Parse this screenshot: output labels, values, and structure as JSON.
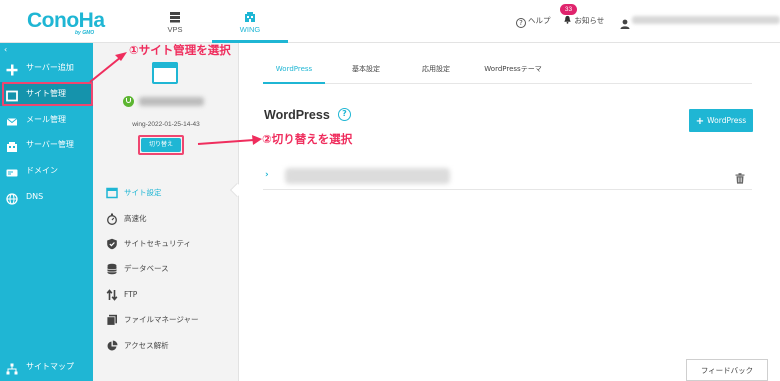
{
  "header": {
    "logo": {
      "text": "ConoHa",
      "sub": "by GMO"
    },
    "service_tabs": [
      {
        "label": "VPS"
      },
      {
        "label": "WING"
      }
    ],
    "help_label": "ヘルプ",
    "notice_label": "お知らせ",
    "notice_count": "33"
  },
  "sidebar": {
    "items": [
      {
        "label": "サーバー追加"
      },
      {
        "label": "サイト管理"
      },
      {
        "label": "メール管理"
      },
      {
        "label": "サーバー管理"
      },
      {
        "label": "ドメイン"
      },
      {
        "label": "DNS"
      }
    ],
    "bottom_label": "サイトマップ"
  },
  "site_panel": {
    "site_id": "wing-2022-01-25-14-43",
    "switch_button": "切り替え",
    "menu": [
      {
        "label": "サイト設定"
      },
      {
        "label": "高速化"
      },
      {
        "label": "サイトセキュリティ"
      },
      {
        "label": "データベース"
      },
      {
        "label": "FTP"
      },
      {
        "label": "ファイルマネージャー"
      },
      {
        "label": "アクセス解析"
      }
    ]
  },
  "main": {
    "tabs": [
      {
        "label": "WordPress"
      },
      {
        "label": "基本設定"
      },
      {
        "label": "応用設定"
      },
      {
        "label": "WordPressテーマ"
      }
    ],
    "title": "WordPress",
    "add_button": "WordPress",
    "feedback_button": "フィードバック"
  },
  "annotations": {
    "step1": "①サイト管理を選択",
    "step2": "②切り替えを選択"
  },
  "colors": {
    "accent": "#1fb6d4",
    "annotation": "#ef2d5d",
    "status_ok": "#5cb531"
  }
}
